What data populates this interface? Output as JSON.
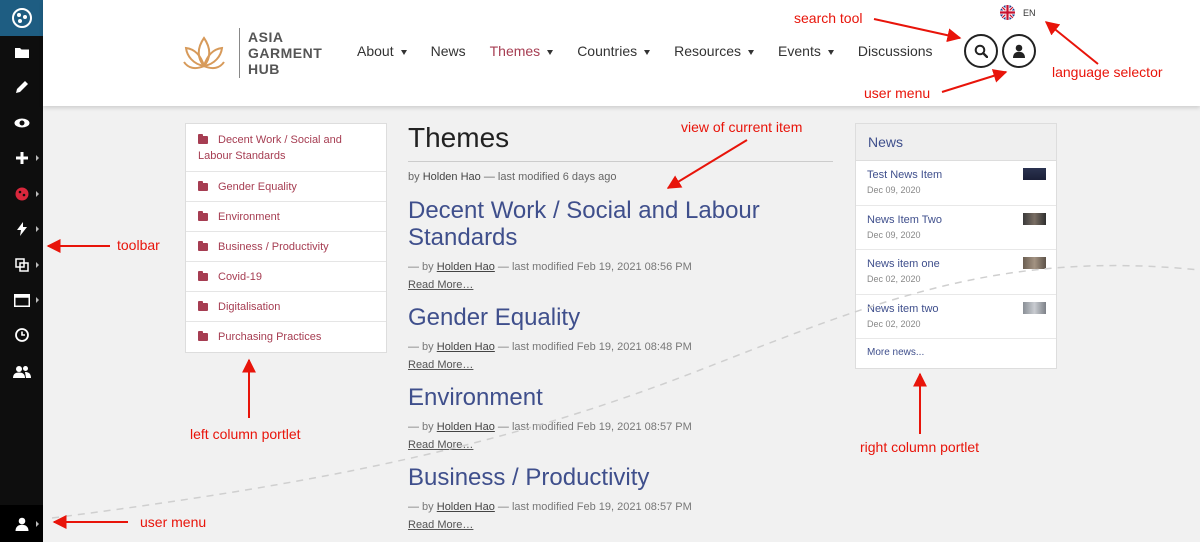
{
  "toolbar": {
    "items": [
      "plone-logo-icon",
      "folder-icon",
      "edit-icon",
      "view-icon",
      "add-icon",
      "workflow-icon",
      "actions-icon",
      "manage-portlets-icon",
      "display-icon",
      "history-icon",
      "sharing-icon"
    ],
    "user_icon": "user-icon"
  },
  "header": {
    "logo_lines": [
      "ASIA",
      "GARMENT",
      "HUB"
    ],
    "nav": [
      {
        "label": "About",
        "dropdown": true
      },
      {
        "label": "News",
        "dropdown": false
      },
      {
        "label": "Themes",
        "dropdown": true,
        "active": true
      },
      {
        "label": "Countries",
        "dropdown": true
      },
      {
        "label": "Resources",
        "dropdown": true
      },
      {
        "label": "Events",
        "dropdown": true
      },
      {
        "label": "Discussions",
        "dropdown": false
      }
    ],
    "language": "EN"
  },
  "left_portlet": {
    "items": [
      "Decent Work / Social and Labour Standards",
      "Gender Equality",
      "Environment",
      "Business / Productivity",
      "Covid-19",
      "Digitalisation",
      "Purchasing Practices"
    ]
  },
  "main": {
    "title": "Themes",
    "byline": {
      "prefix": "by",
      "author": "Holden Hao",
      "suffix": "— last modified 6 days ago"
    },
    "items": [
      {
        "title": "Decent Work / Social and Labour Standards",
        "meta_prefix": "— by",
        "author": "Holden Hao",
        "modified": "— last modified Feb 19, 2021 08:56 PM",
        "read_more": "Read More…"
      },
      {
        "title": "Gender Equality",
        "meta_prefix": "— by",
        "author": "Holden Hao",
        "modified": "— last modified Feb 19, 2021 08:48 PM",
        "read_more": "Read More…"
      },
      {
        "title": "Environment",
        "meta_prefix": "— by",
        "author": "Holden Hao",
        "modified": "— last modified Feb 19, 2021 08:57 PM",
        "read_more": "Read More…"
      },
      {
        "title": "Business / Productivity",
        "meta_prefix": "— by",
        "author": "Holden Hao",
        "modified": "— last modified Feb 19, 2021 08:57 PM",
        "read_more": "Read More…"
      }
    ]
  },
  "right_portlet": {
    "title": "News",
    "items": [
      {
        "title": "Test News Item",
        "date": "Dec 09, 2020"
      },
      {
        "title": "News Item Two",
        "date": "Dec 09, 2020"
      },
      {
        "title": "News item one",
        "date": "Dec 02, 2020"
      },
      {
        "title": "News item two",
        "date": "Dec 02, 2020"
      }
    ],
    "more": "More news..."
  },
  "annotations": {
    "search_tool": "search tool",
    "language_selector": "language selector",
    "user_menu_top": "user menu",
    "view_current_item": "view of current item",
    "toolbar": "toolbar",
    "left_column_portlet": "left column portlet",
    "right_column_portlet": "right column portlet",
    "user_menu_bottom": "user menu",
    "color": "#e8140a"
  },
  "colors": {
    "accent": "#a63d52",
    "link_blue": "#3f4f8c",
    "toolbar_bg": "#0e0e0e",
    "toolbar_top_bg": "#1e5d82"
  }
}
